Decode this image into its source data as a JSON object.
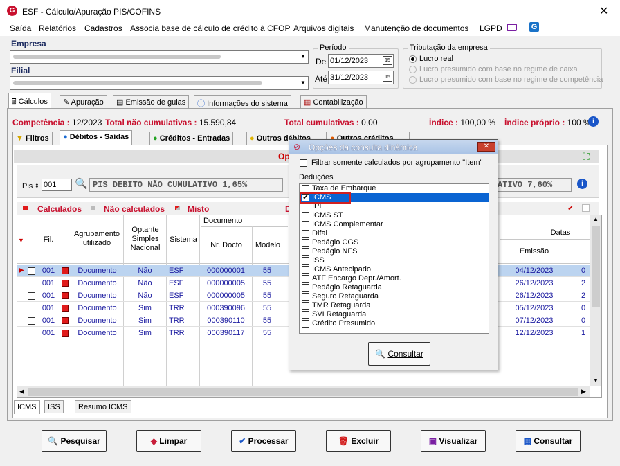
{
  "window": {
    "title": "ESF - Cálculo/Apuração PIS/COFINS",
    "close": "✕"
  },
  "menu": [
    "Saída",
    "Relatórios",
    "Cadastros",
    "Associa base de cálculo de crédito à CFOP",
    "Arquivos digitais",
    "Manutenção de documentos",
    "LGPD"
  ],
  "empresa": {
    "label": "Empresa",
    "filial_label": "Filial"
  },
  "periodo": {
    "label": "Período",
    "de_label": "De",
    "de": "01/12/2023",
    "ate_label": "Até",
    "ate": "31/12/2023"
  },
  "tributacao": {
    "label": "Tributação da empresa",
    "options": [
      "Lucro real",
      "Lucro presumido com base no regime de caixa",
      "Lucro presumido com base no regime de competência"
    ],
    "selected": 0
  },
  "tabs": [
    "Cálculos",
    "Apuração",
    "Emissão de guias",
    "Informações do sistema",
    "Contabilização"
  ],
  "summary": {
    "competencia_label": "Competência :",
    "competencia": "12/2023",
    "total_nao_label": "Total não cumulativas :",
    "total_nao": "15.590,84",
    "total_cum_label": "Total cumulativas :",
    "total_cum": "0,00",
    "indice_label": "Índice :",
    "indice": "100,00 %",
    "indice_proprio_label": "Índice próprio :",
    "indice_proprio": "100 %"
  },
  "subtabs": [
    "Filtros",
    "Débitos - Saídas",
    "Créditos - Entradas",
    "Outros débitos",
    "Outros créditos"
  ],
  "pis": {
    "label": "Pis",
    "code": "001",
    "desc": "PIS DEBITO  NÃO CUMULATIVO 1,65%",
    "desc_right": "ATIVO 7,60%"
  },
  "legend": {
    "calculados": "Calculados",
    "nao_calculados": "Não calculados",
    "misto": "Misto"
  },
  "columns": {
    "fil": "Fil.",
    "agrupamento": "Agrupamento utilizado",
    "optante": "Optante Simples Nacional",
    "sistema": "Sistema",
    "documento": "Documento",
    "nr_docto": "Nr. Docto",
    "modelo": "Modelo",
    "datas": "Datas",
    "emissao": "Emissão"
  },
  "rows": [
    {
      "fil": "001",
      "agrup": "Documento",
      "opt": "Não",
      "sis": "ESF",
      "nr": "000000001",
      "mod": "55",
      "emissao": "04/12/2023",
      "extra": "0"
    },
    {
      "fil": "001",
      "agrup": "Documento",
      "opt": "Não",
      "sis": "ESF",
      "nr": "000000005",
      "mod": "55",
      "emissao": "26/12/2023",
      "extra": "2"
    },
    {
      "fil": "001",
      "agrup": "Documento",
      "opt": "Não",
      "sis": "ESF",
      "nr": "000000005",
      "mod": "55",
      "emissao": "26/12/2023",
      "extra": "2"
    },
    {
      "fil": "001",
      "agrup": "Documento",
      "opt": "Sim",
      "sis": "TRR",
      "nr": "000390096",
      "mod": "55",
      "emissao": "05/12/2023",
      "extra": "0"
    },
    {
      "fil": "001",
      "agrup": "Documento",
      "opt": "Sim",
      "sis": "TRR",
      "nr": "000390110",
      "mod": "55",
      "emissao": "07/12/2023",
      "extra": "0"
    },
    {
      "fil": "001",
      "agrup": "Documento",
      "opt": "Sim",
      "sis": "TRR",
      "nr": "000390117",
      "mod": "55",
      "emissao": "12/12/2023",
      "extra": "1"
    }
  ],
  "bottom_tabs": [
    "ICMS",
    "ISS",
    "Resumo ICMS"
  ],
  "buttons": [
    "Pesquisar",
    "Limpar",
    "Processar",
    "Excluir",
    "Visualizar",
    "Consultar"
  ],
  "popup": {
    "title": "Opções da consulta dinâmica",
    "filter_label": "Filtrar somente calculados por agrupamento \"Item\"",
    "deducoes_label": "Deduções",
    "items": [
      "Taxa de Embarque",
      "ICMS",
      "IPI",
      "ICMS ST",
      "ICMS Complementar",
      "Difal",
      "Pedágio CGS",
      "Pedágio NFS",
      "ISS",
      "ICMS Antecipado",
      "ATF Encargo Depr./Amort.",
      "Pedágio Retaguarda",
      "Seguro Retaguarda",
      "TMR Retaguarda",
      "SVI Retaguarda",
      "Crédito Presumido"
    ],
    "checked_index": 1,
    "button": "Consultar"
  },
  "colors": {
    "accent_red": "#c8102e",
    "selection": "#0a64d2",
    "link_blue": "#1a1aa0"
  }
}
